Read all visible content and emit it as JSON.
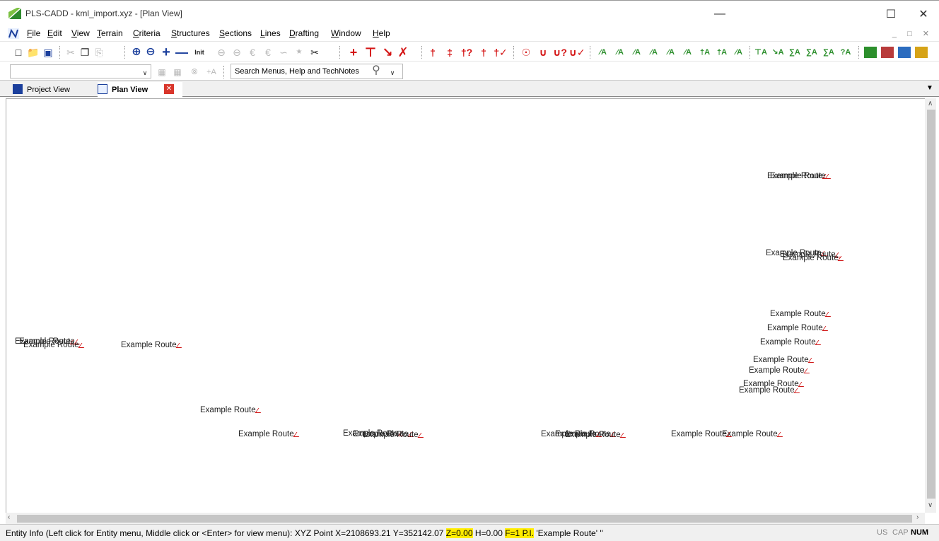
{
  "window": {
    "title": "PLS-CADD - kml_import.xyz - [Plan View]"
  },
  "menu": {
    "file": "File",
    "edit": "Edit",
    "view": "View",
    "terrain": "Terrain",
    "criteria": "Criteria",
    "structures": "Structures",
    "sections": "Sections",
    "lines": "Lines",
    "drafting": "Drafting",
    "window": "Window",
    "help": "Help"
  },
  "toolbar": {
    "init_label": "Init"
  },
  "search": {
    "placeholder": "Search Menus, Help and TechNotes"
  },
  "tabs": {
    "project_view": "Project View",
    "plan_view": "Plan View"
  },
  "plan_view": {
    "labels": [
      "Example Route",
      "Example Route",
      "Example Route",
      "Example Route",
      "Example Route",
      "Example Route",
      "Example Route",
      "Example Route",
      "Example Route",
      "Example Route",
      "Example Route",
      "Example Route",
      "Example Route",
      "Example Route",
      "Example Route",
      "Example Route",
      "Example Route",
      "Example Route",
      "Example Route",
      "Example Route",
      "Example Route",
      "Example Route",
      "Example Route",
      "Example Route",
      "Example Route",
      "Example Route",
      "Example Route",
      "Example Route",
      "Example Route",
      "Example Route"
    ]
  },
  "status": {
    "prefix": "Entity Info (Left click for Entity menu, Middle click or <Enter> for view menu):  XYZ Point  X=2108693.21 Y=352142.07",
    "z": "Z=0.00",
    "h": "H=0.00",
    "f": "F=1 P.I.",
    "suffix": "'Example Route' ''",
    "indicators": {
      "us": "US",
      "cap": "CAP",
      "num": "NUM"
    }
  },
  "colors": {
    "accent": "#ffec00",
    "route_marker": "#d01818",
    "close_tab": "#d9362b"
  }
}
